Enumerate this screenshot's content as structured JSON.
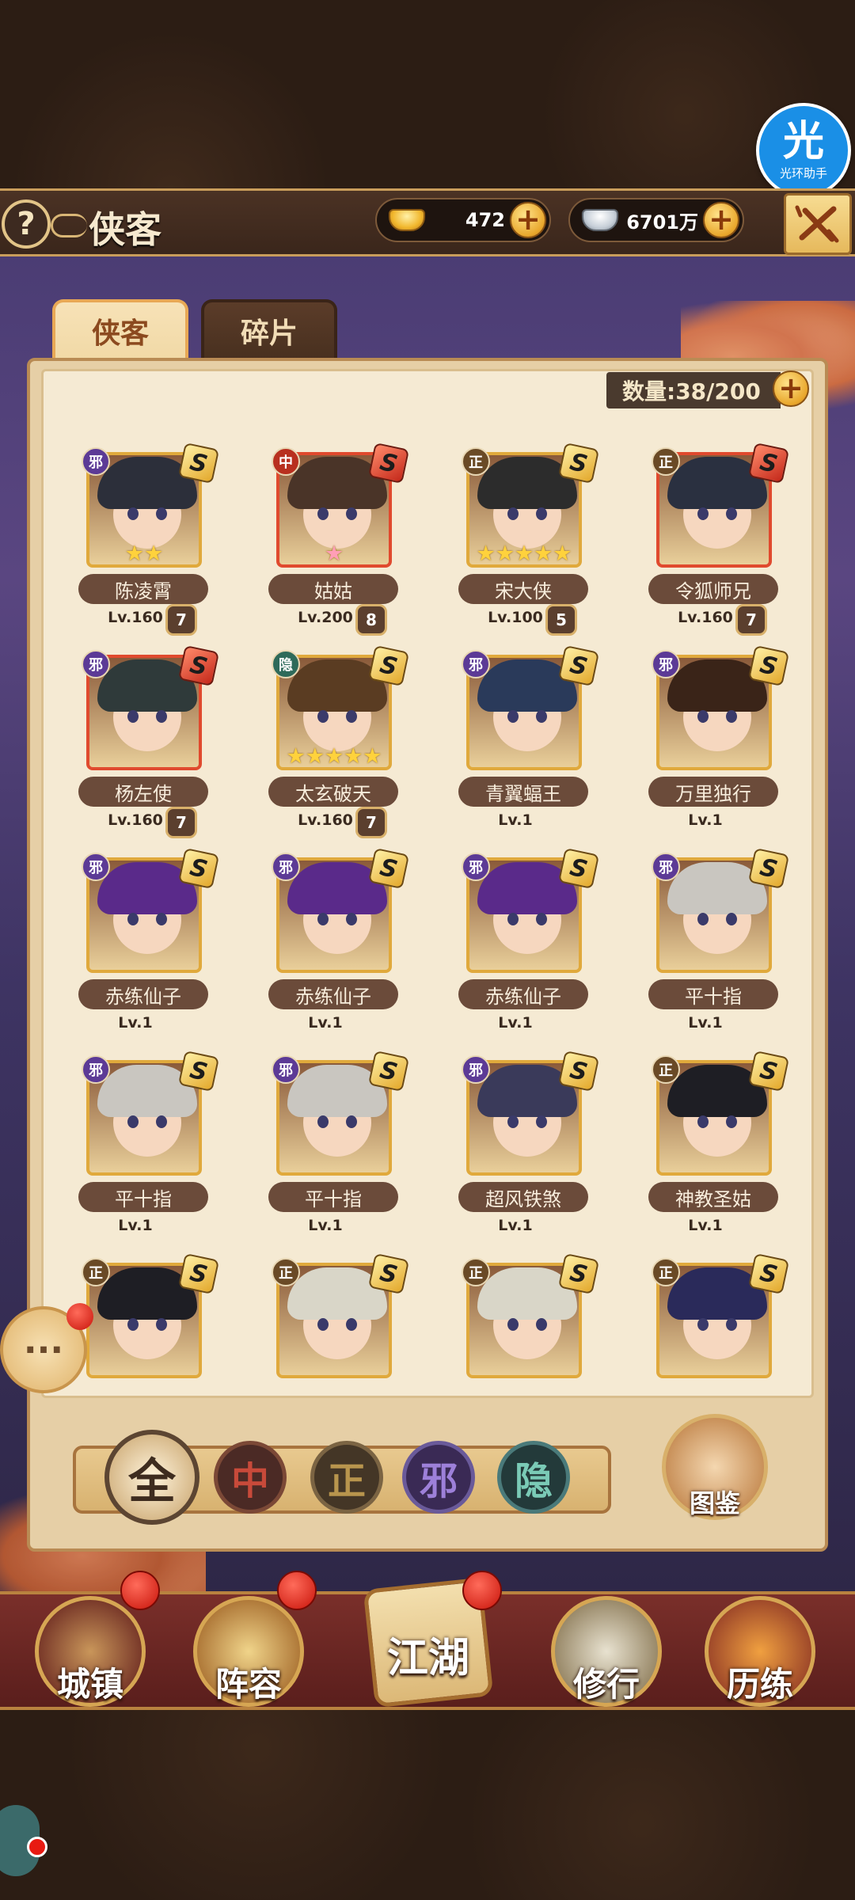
{
  "assistant": {
    "big": "光",
    "label": "光环助手"
  },
  "header": {
    "help": "?",
    "title": "侠客",
    "gold": "472",
    "silver": "6701万"
  },
  "tabs": [
    {
      "label": "侠客",
      "active": true
    },
    {
      "label": "碎片",
      "active": false
    }
  ],
  "quantity": "数量:38/200",
  "heroes": [
    {
      "name": "陈凌霄",
      "faction": "邪",
      "rank": "S",
      "rank_color": "gold",
      "level": "Lv.160",
      "stars": 2,
      "star_color": "gold",
      "badge": "7",
      "hair": "#2c2f3a"
    },
    {
      "name": "姑姑",
      "faction": "中",
      "rank": "S",
      "rank_color": "red",
      "level": "Lv.200",
      "stars": 1,
      "star_color": "pink",
      "badge": "8",
      "hair": "#4a3428"
    },
    {
      "name": "宋大侠",
      "faction": "正",
      "rank": "S",
      "rank_color": "gold",
      "level": "Lv.100",
      "stars": 5,
      "star_color": "gold",
      "badge": "5",
      "hair": "#2c2c2c"
    },
    {
      "name": "令狐师兄",
      "faction": "正",
      "rank": "S",
      "rank_color": "red",
      "level": "Lv.160",
      "stars": 0,
      "star_color": "gold",
      "badge": "7",
      "hair": "#2a3040"
    },
    {
      "name": "杨左使",
      "faction": "邪",
      "rank": "S",
      "rank_color": "red",
      "level": "Lv.160",
      "stars": 0,
      "star_color": "gold",
      "badge": "7",
      "hair": "#2f3a3a"
    },
    {
      "name": "太玄破天",
      "faction": "隐",
      "rank": "S",
      "rank_color": "gold",
      "level": "Lv.160",
      "stars": 5,
      "star_color": "gold",
      "badge": "7",
      "hair": "#5a3c22"
    },
    {
      "name": "青翼蝠王",
      "faction": "邪",
      "rank": "S",
      "rank_color": "gold",
      "level": "Lv.1",
      "stars": 0,
      "star_color": "gold",
      "badge": "",
      "hair": "#2a3a5a"
    },
    {
      "name": "万里独行",
      "faction": "邪",
      "rank": "S",
      "rank_color": "gold",
      "level": "Lv.1",
      "stars": 0,
      "star_color": "gold",
      "badge": "",
      "hair": "#3a2418"
    },
    {
      "name": "赤练仙子",
      "faction": "邪",
      "rank": "S",
      "rank_color": "gold",
      "level": "Lv.1",
      "stars": 0,
      "star_color": "gold",
      "badge": "",
      "hair": "#5a2a8a"
    },
    {
      "name": "赤练仙子",
      "faction": "邪",
      "rank": "S",
      "rank_color": "gold",
      "level": "Lv.1",
      "stars": 0,
      "star_color": "gold",
      "badge": "",
      "hair": "#5a2a8a"
    },
    {
      "name": "赤练仙子",
      "faction": "邪",
      "rank": "S",
      "rank_color": "gold",
      "level": "Lv.1",
      "stars": 0,
      "star_color": "gold",
      "badge": "",
      "hair": "#5a2a8a"
    },
    {
      "name": "平十指",
      "faction": "邪",
      "rank": "S",
      "rank_color": "gold",
      "level": "Lv.1",
      "stars": 0,
      "star_color": "gold",
      "badge": "",
      "hair": "#c9c6c0"
    },
    {
      "name": "平十指",
      "faction": "邪",
      "rank": "S",
      "rank_color": "gold",
      "level": "Lv.1",
      "stars": 0,
      "star_color": "gold",
      "badge": "",
      "hair": "#c9c6c0"
    },
    {
      "name": "平十指",
      "faction": "邪",
      "rank": "S",
      "rank_color": "gold",
      "level": "Lv.1",
      "stars": 0,
      "star_color": "gold",
      "badge": "",
      "hair": "#c9c6c0"
    },
    {
      "name": "超风铁煞",
      "faction": "邪",
      "rank": "S",
      "rank_color": "gold",
      "level": "Lv.1",
      "stars": 0,
      "star_color": "gold",
      "badge": "",
      "hair": "#3a3a5a"
    },
    {
      "name": "神教圣姑",
      "faction": "正",
      "rank": "S",
      "rank_color": "gold",
      "level": "Lv.1",
      "stars": 0,
      "star_color": "gold",
      "badge": "",
      "hair": "#1e1e24"
    },
    {
      "name": "",
      "faction": "正",
      "rank": "S",
      "rank_color": "gold",
      "level": "",
      "stars": 0,
      "star_color": "gold",
      "badge": "",
      "hair": "#1e1e24"
    },
    {
      "name": "",
      "faction": "正",
      "rank": "S",
      "rank_color": "gold",
      "level": "",
      "stars": 0,
      "star_color": "gold",
      "badge": "",
      "hair": "#d9d6c8"
    },
    {
      "name": "",
      "faction": "正",
      "rank": "S",
      "rank_color": "gold",
      "level": "",
      "stars": 0,
      "star_color": "gold",
      "badge": "",
      "hair": "#d9d6c8"
    },
    {
      "name": "",
      "faction": "正",
      "rank": "S",
      "rank_color": "gold",
      "level": "",
      "stars": 0,
      "star_color": "gold",
      "badge": "",
      "hair": "#2a2a5a"
    }
  ],
  "filters": {
    "all": "全",
    "zhong": "中",
    "zheng": "正",
    "xie": "邪",
    "yin": "隐"
  },
  "codex": "图鉴",
  "chat_icon": "···",
  "nav": {
    "town": "城镇",
    "lineup": "阵容",
    "jianghu": "江湖",
    "cultivate": "修行",
    "training": "历练"
  }
}
